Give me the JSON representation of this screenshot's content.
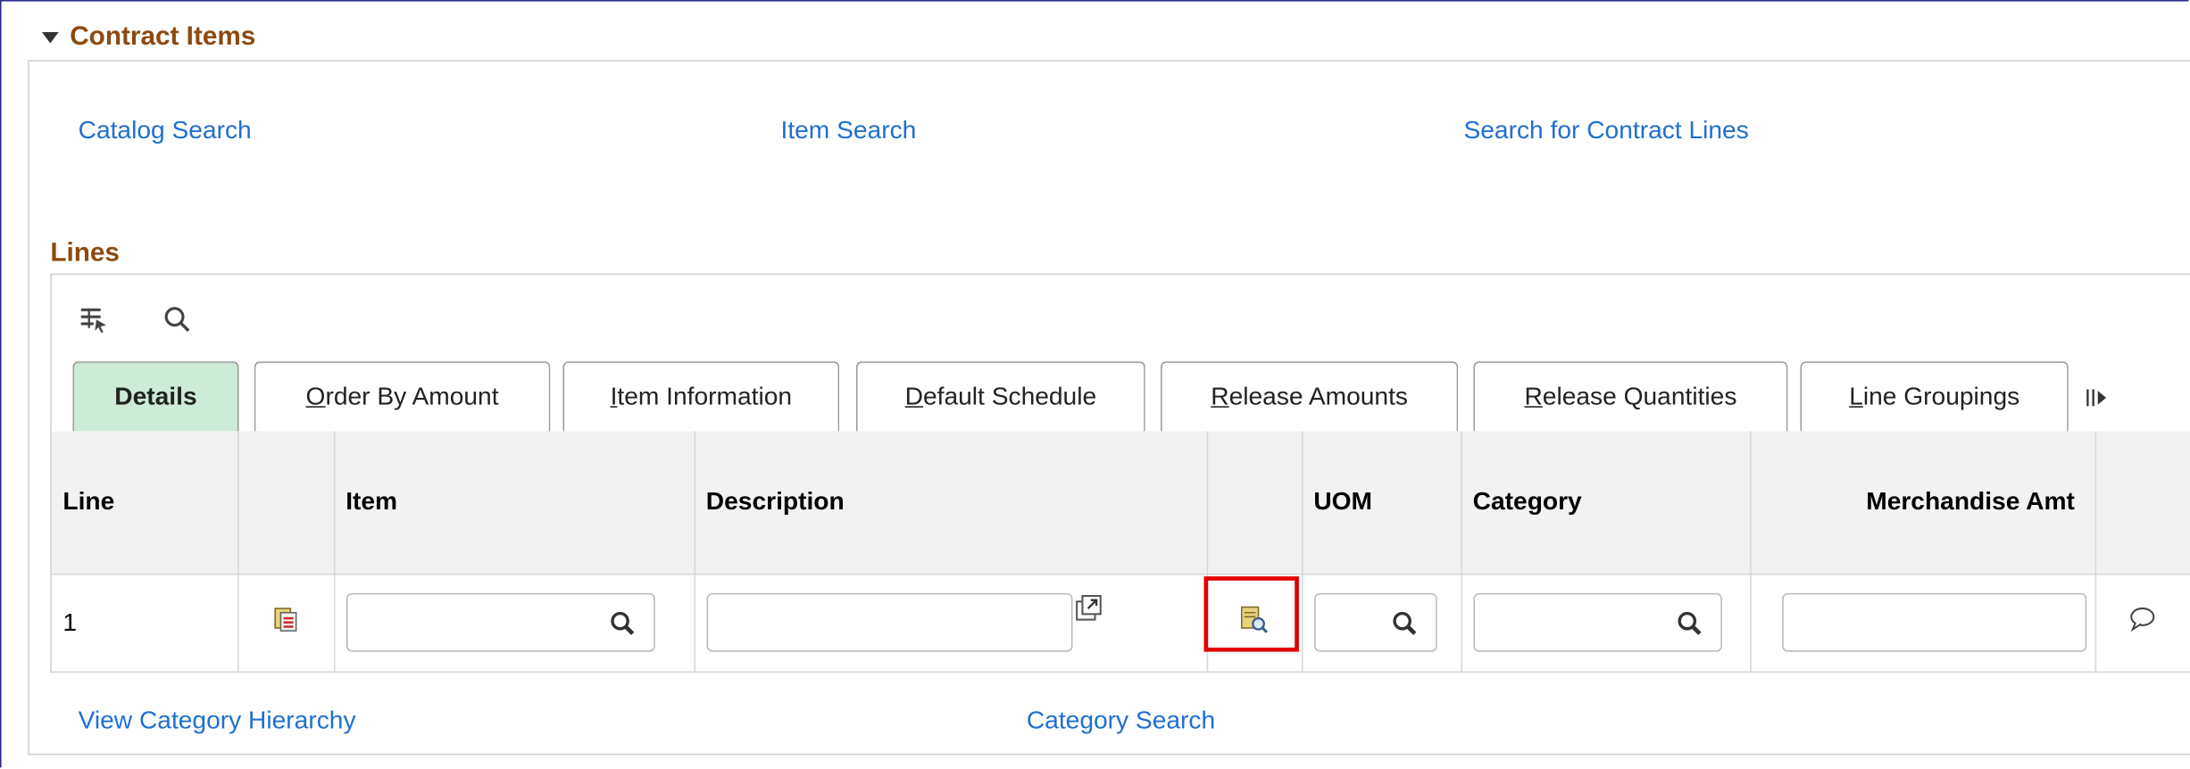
{
  "section": {
    "title": "Contract Items"
  },
  "links_top": {
    "catalog_search": "Catalog Search",
    "item_search": "Item Search",
    "search_contract_lines": "Search for Contract Lines"
  },
  "lines": {
    "title": "Lines",
    "toolbar": {
      "personalize_icon": "grid-settings-icon",
      "find_icon": "search-icon"
    },
    "tabs": [
      {
        "label": "Details",
        "active": true
      },
      {
        "label": "Order By Amount",
        "underline": "O",
        "rest": "rder By Amount"
      },
      {
        "label": "Item Information",
        "underline": "I",
        "rest": "tem Information"
      },
      {
        "label": "Default Schedule",
        "underline": "D",
        "rest": "efault Schedule"
      },
      {
        "label": "Release Amounts",
        "underline": "R",
        "rest": "elease Amounts"
      },
      {
        "label": "Release Quantities",
        "underline": "R",
        "rest": "elease Quantities"
      },
      {
        "label": "Line Groupings",
        "underline": "L",
        "rest": "ine Groupings"
      }
    ],
    "more_tabs_icon": "show-all-columns-icon",
    "columns": [
      "Line",
      "",
      "Item",
      "Description",
      "",
      "UOM",
      "Category",
      "Merchandise Amt",
      ""
    ],
    "rows": [
      {
        "line": "1",
        "item": "",
        "description": "",
        "uom": "",
        "category": "",
        "merchandise_amt": ""
      }
    ]
  },
  "links_bottom": {
    "view_category_hierarchy": "View Category Hierarchy",
    "category_search": "Category Search"
  },
  "colors": {
    "link": "#1f6fd1",
    "header": "#8c4a10",
    "active_tab": "#cdebd6",
    "highlight": "#e30000"
  }
}
